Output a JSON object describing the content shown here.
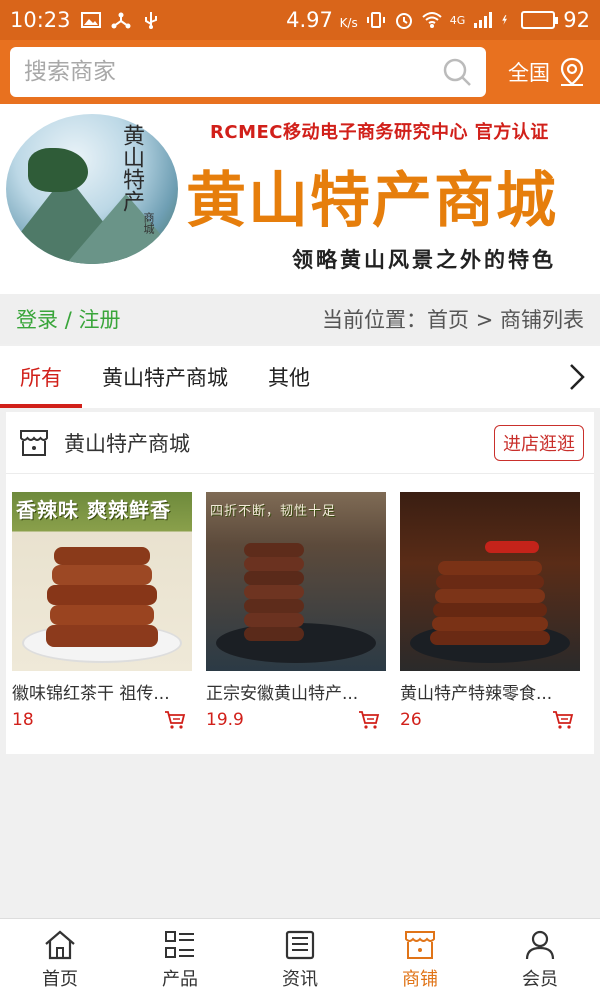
{
  "status_bar": {
    "time": "10:23",
    "speed": "4.97",
    "speed_unit": "K/s",
    "network": "4G",
    "battery": "92",
    "battery_level": 0.92
  },
  "search": {
    "placeholder": "搜索商家",
    "region_label": "全国"
  },
  "banner": {
    "logo_text": "黄山特产",
    "logo_subtext": "商城",
    "org_text": "RCMEC移动电子商务研究中心 官方认证",
    "title": "黄山特产商城",
    "slogan": "领略黄山风景之外的特色"
  },
  "location_bar": {
    "login": "登录",
    "separator": "/",
    "register": "注册",
    "position": "当前位置：首页 > 商铺列表"
  },
  "tabs": [
    {
      "label": "所有",
      "active": true
    },
    {
      "label": "黄山特产商城",
      "active": false
    },
    {
      "label": "其他",
      "active": false
    }
  ],
  "store": {
    "name": "黄山特产商城",
    "visit_label": "进店逛逛",
    "products": [
      {
        "name": "徽味锦红茶干 祖传...",
        "price": "18",
        "image_caption": "香辣味 爽辣鲜香"
      },
      {
        "name": "正宗安徽黄山特产...",
        "price": "19.9",
        "image_caption": "四折不断，韧性十足"
      },
      {
        "name": "黄山特产特辣零食...",
        "price": "26",
        "image_caption": ""
      }
    ]
  },
  "bottom_nav": [
    {
      "label": "首页",
      "icon": "home-icon",
      "active": false
    },
    {
      "label": "产品",
      "icon": "list-icon",
      "active": false
    },
    {
      "label": "资讯",
      "icon": "news-icon",
      "active": false
    },
    {
      "label": "商铺",
      "icon": "store-icon",
      "active": true
    },
    {
      "label": "会员",
      "icon": "user-icon",
      "active": false
    }
  ],
  "colors": {
    "brand_orange": "#e8711f",
    "accent_red": "#d1201a",
    "login_green": "#39a53a",
    "active_nav": "#e07418"
  }
}
